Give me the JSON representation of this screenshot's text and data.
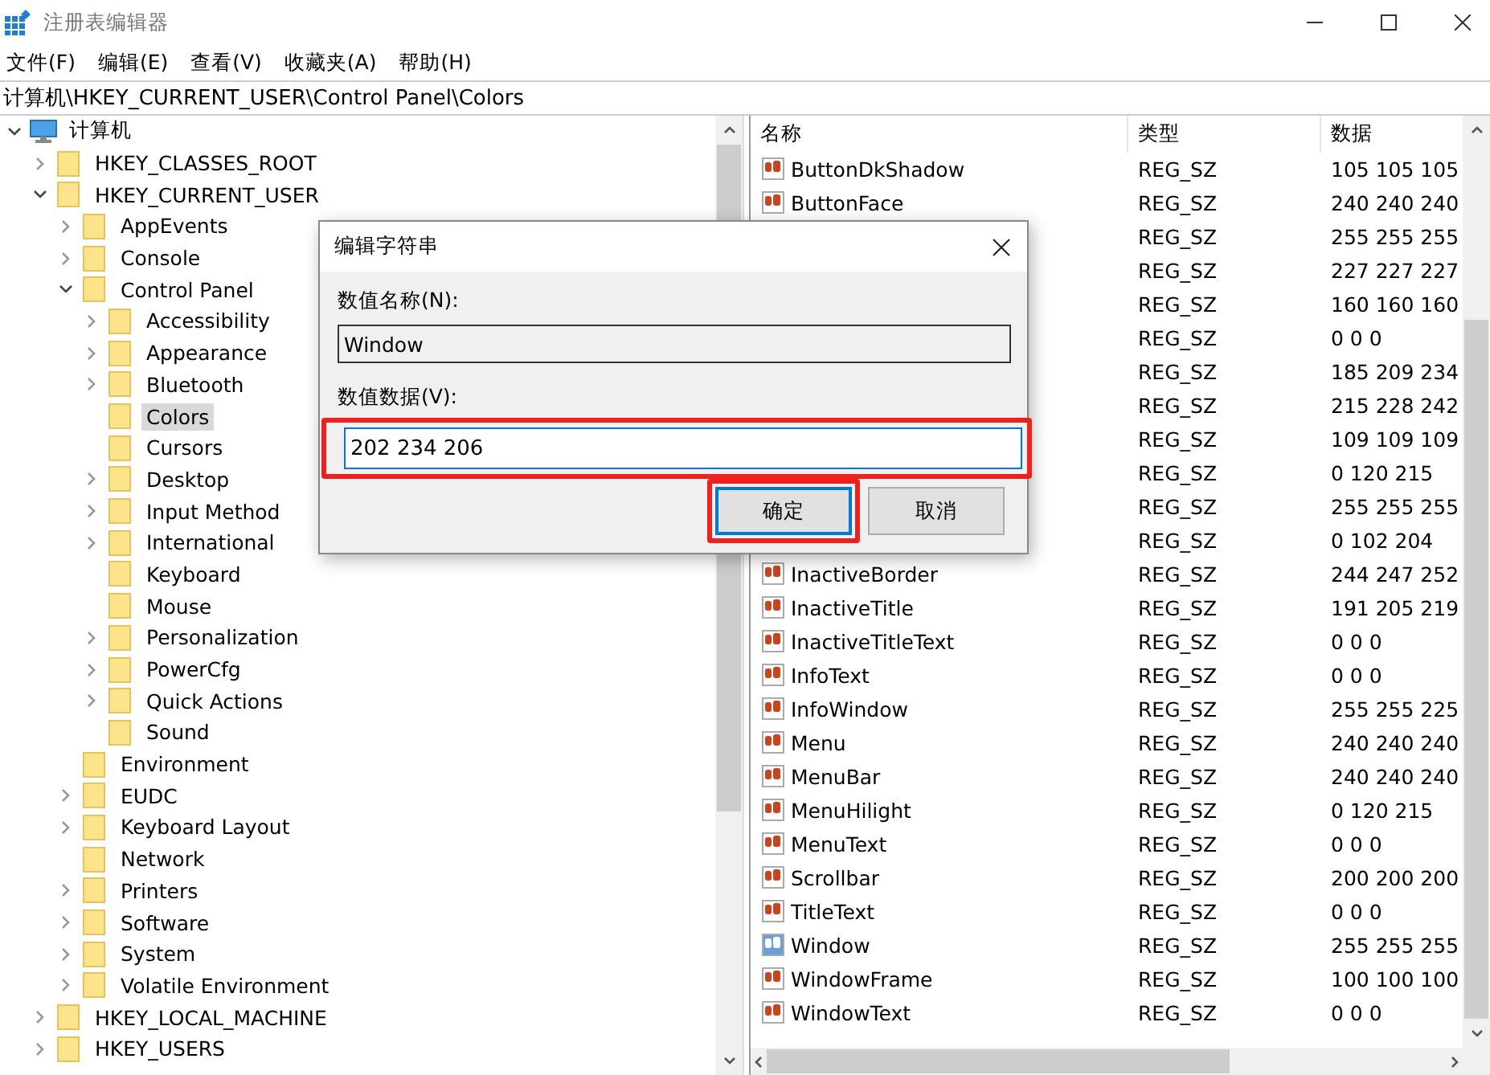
{
  "window": {
    "title": "注册表编辑器"
  },
  "menu": [
    "文件(F)",
    "编辑(E)",
    "查看(V)",
    "收藏夹(A)",
    "帮助(H)"
  ],
  "address": "计算机\\HKEY_CURRENT_USER\\Control Panel\\Colors",
  "tree": [
    {
      "label": "计算机",
      "kind": "computer",
      "expanded": true,
      "selected": false,
      "children": [
        {
          "label": "HKEY_CLASSES_ROOT",
          "kind": "folder",
          "expanded": false,
          "selected": false
        },
        {
          "label": "HKEY_CURRENT_USER",
          "kind": "folder",
          "expanded": true,
          "selected": false,
          "children": [
            {
              "label": "AppEvents",
              "kind": "folder",
              "expanded": false,
              "selected": false
            },
            {
              "label": "Console",
              "kind": "folder",
              "expanded": false,
              "selected": false
            },
            {
              "label": "Control Panel",
              "kind": "folder",
              "expanded": true,
              "selected": false,
              "children": [
                {
                  "label": "Accessibility",
                  "kind": "folder",
                  "expanded": false,
                  "selected": false
                },
                {
                  "label": "Appearance",
                  "kind": "folder",
                  "expanded": false,
                  "selected": false
                },
                {
                  "label": "Bluetooth",
                  "kind": "folder",
                  "expanded": false,
                  "selected": false
                },
                {
                  "label": "Colors",
                  "kind": "folder",
                  "selected": true
                },
                {
                  "label": "Cursors",
                  "kind": "folder",
                  "selected": false
                },
                {
                  "label": "Desktop",
                  "kind": "folder",
                  "expanded": false,
                  "selected": false
                },
                {
                  "label": "Input Method",
                  "kind": "folder",
                  "expanded": false,
                  "selected": false
                },
                {
                  "label": "International",
                  "kind": "folder",
                  "expanded": false,
                  "selected": false
                },
                {
                  "label": "Keyboard",
                  "kind": "folder",
                  "selected": false
                },
                {
                  "label": "Mouse",
                  "kind": "folder",
                  "selected": false
                },
                {
                  "label": "Personalization",
                  "kind": "folder",
                  "expanded": false,
                  "selected": false
                },
                {
                  "label": "PowerCfg",
                  "kind": "folder",
                  "expanded": false,
                  "selected": false
                },
                {
                  "label": "Quick Actions",
                  "kind": "folder",
                  "expanded": false,
                  "selected": false
                },
                {
                  "label": "Sound",
                  "kind": "folder",
                  "selected": false
                }
              ]
            },
            {
              "label": "Environment",
              "kind": "folder",
              "selected": false
            },
            {
              "label": "EUDC",
              "kind": "folder",
              "expanded": false,
              "selected": false
            },
            {
              "label": "Keyboard Layout",
              "kind": "folder",
              "expanded": false,
              "selected": false
            },
            {
              "label": "Network",
              "kind": "folder",
              "selected": false
            },
            {
              "label": "Printers",
              "kind": "folder",
              "expanded": false,
              "selected": false
            },
            {
              "label": "Software",
              "kind": "folder",
              "expanded": false,
              "selected": false
            },
            {
              "label": "System",
              "kind": "folder",
              "expanded": false,
              "selected": false
            },
            {
              "label": "Volatile Environment",
              "kind": "folder",
              "expanded": false,
              "selected": false
            }
          ]
        },
        {
          "label": "HKEY_LOCAL_MACHINE",
          "kind": "folder",
          "expanded": false,
          "selected": false
        },
        {
          "label": "HKEY_USERS",
          "kind": "folder",
          "expanded": false,
          "selected": false
        }
      ]
    }
  ],
  "values": {
    "columns": [
      "名称",
      "类型",
      "数据"
    ],
    "rows": [
      {
        "name": "ButtonDkShadow",
        "type": "REG_SZ",
        "data": "105 105 105",
        "selected": false
      },
      {
        "name": "ButtonFace",
        "type": "REG_SZ",
        "data": "240 240 240",
        "selected": false
      },
      {
        "type": "REG_SZ",
        "data": "255 255 255"
      },
      {
        "type": "REG_SZ",
        "data": "227 227 227"
      },
      {
        "type": "REG_SZ",
        "data": "160 160 160"
      },
      {
        "type": "REG_SZ",
        "data": "0 0 0"
      },
      {
        "type": "REG_SZ",
        "data": "185 209 234"
      },
      {
        "type": "REG_SZ",
        "data": "215 228 242"
      },
      {
        "type": "REG_SZ",
        "data": "109 109 109"
      },
      {
        "type": "REG_SZ",
        "data": "0 120 215"
      },
      {
        "type": "REG_SZ",
        "data": "255 255 255"
      },
      {
        "type": "REG_SZ",
        "data": "0 102 204"
      },
      {
        "name": "InactiveBorder",
        "type": "REG_SZ",
        "data": "244 247 252",
        "selected": false
      },
      {
        "name": "InactiveTitle",
        "type": "REG_SZ",
        "data": "191 205 219",
        "selected": false
      },
      {
        "name": "InactiveTitleText",
        "type": "REG_SZ",
        "data": "0 0 0",
        "selected": false
      },
      {
        "name": "InfoText",
        "type": "REG_SZ",
        "data": "0 0 0",
        "selected": false
      },
      {
        "name": "InfoWindow",
        "type": "REG_SZ",
        "data": "255 255 225",
        "selected": false
      },
      {
        "name": "Menu",
        "type": "REG_SZ",
        "data": "240 240 240",
        "selected": false
      },
      {
        "name": "MenuBar",
        "type": "REG_SZ",
        "data": "240 240 240",
        "selected": false
      },
      {
        "name": "MenuHilight",
        "type": "REG_SZ",
        "data": "0 120 215",
        "selected": false
      },
      {
        "name": "MenuText",
        "type": "REG_SZ",
        "data": "0 0 0",
        "selected": false
      },
      {
        "name": "Scrollbar",
        "type": "REG_SZ",
        "data": "200 200 200",
        "selected": false
      },
      {
        "name": "TitleText",
        "type": "REG_SZ",
        "data": "0 0 0",
        "selected": false
      },
      {
        "name": "Window",
        "type": "REG_SZ",
        "data": "255 255 255",
        "selected": true
      },
      {
        "name": "WindowFrame",
        "type": "REG_SZ",
        "data": "100 100 100",
        "selected": false
      },
      {
        "name": "WindowText",
        "type": "REG_SZ",
        "data": "0 0 0",
        "selected": false
      }
    ]
  },
  "dialog": {
    "title": "编辑字符串",
    "name_label": "数值名称(N):",
    "name_value": "Window",
    "data_label": "数值数据(V):",
    "data_value": "202 234 206",
    "data_highlighted": true,
    "buttons": [
      {
        "label": "确定",
        "default": true,
        "highlighted": true
      },
      {
        "label": "取消",
        "default": false,
        "highlighted": false
      }
    ]
  }
}
